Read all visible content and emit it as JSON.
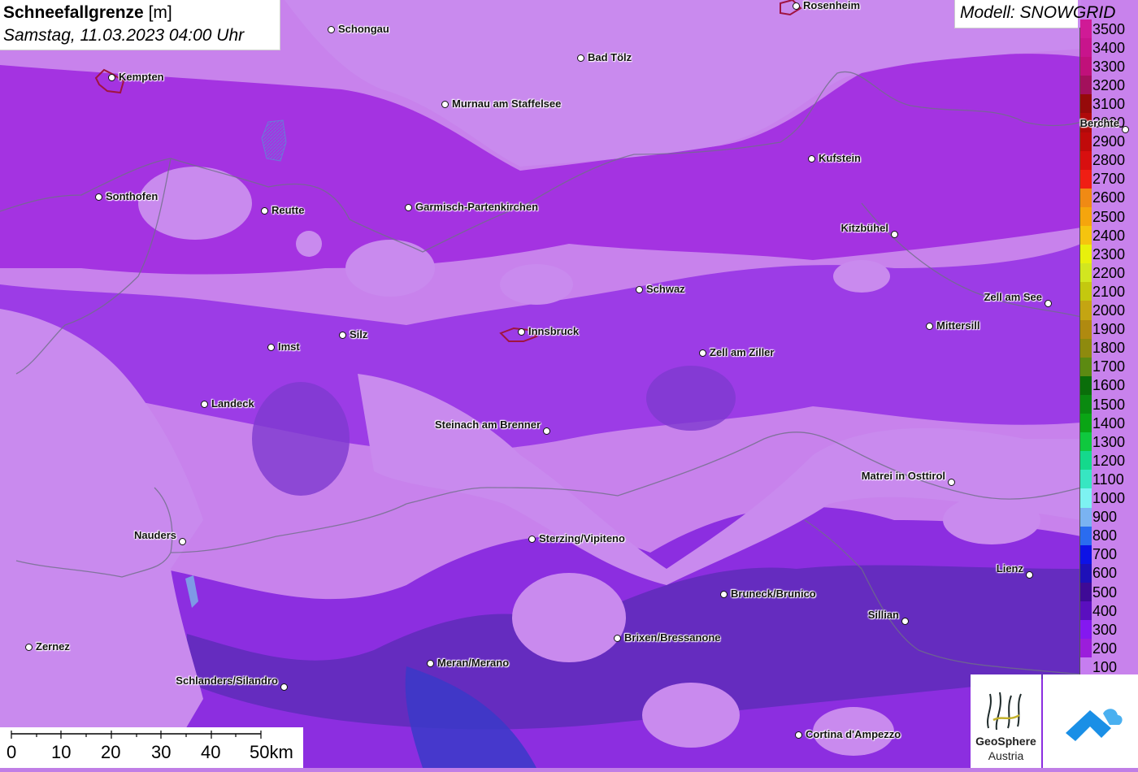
{
  "header": {
    "title_bold": "Schneefallgrenze",
    "title_unit": "[m]",
    "datetime": "Samstag, 11.03.2023 04:00 Uhr",
    "model": "Modell: SNOWGRID"
  },
  "legend": {
    "values": [
      "100",
      "200",
      "300",
      "400",
      "500",
      "600",
      "700",
      "800",
      "900",
      "1000",
      "1100",
      "1200",
      "1300",
      "1400",
      "1500",
      "1600",
      "1700",
      "1800",
      "1900",
      "2000",
      "2100",
      "2200",
      "2300",
      "2400",
      "2500",
      "2600",
      "2700",
      "2800",
      "2900",
      "3000",
      "3100",
      "3200",
      "3300",
      "3400",
      "3500"
    ],
    "colors": [
      "#c67df0",
      "#9b1ddb",
      "#8418f0",
      "#5a0fbf",
      "#3e0a96",
      "#1e10b8",
      "#0d12e6",
      "#2a6cf0",
      "#7ab3f2",
      "#7df2f2",
      "#37e6c2",
      "#14d98c",
      "#0fc83e",
      "#0aa515",
      "#0a8a10",
      "#0a6e0a",
      "#5c8a12",
      "#8e8a0e",
      "#b08a10",
      "#c4a512",
      "#c4c80f",
      "#d2e620",
      "#e8f00c",
      "#f5c40f",
      "#f5a50d",
      "#f08a14",
      "#f01e14",
      "#d80f0f",
      "#c00a0a",
      "#b00a0a",
      "#960a0a",
      "#a3105c",
      "#c0107a",
      "#c8148c",
      "#d01a96"
    ]
  },
  "cities": [
    {
      "name": "Rosenheim"
    },
    {
      "name": "Schongau"
    },
    {
      "name": "Bad Tölz"
    },
    {
      "name": "Kempten"
    },
    {
      "name": "Murnau am Staffelsee"
    },
    {
      "name": "Berchte"
    },
    {
      "name": "Kufstein"
    },
    {
      "name": "Sonthofen"
    },
    {
      "name": "Reutte"
    },
    {
      "name": "Garmisch-Partenkirchen"
    },
    {
      "name": "Kitzbühel"
    },
    {
      "name": "Schwaz"
    },
    {
      "name": "Zell am See"
    },
    {
      "name": "Mittersill"
    },
    {
      "name": "Silz"
    },
    {
      "name": "Innsbruck"
    },
    {
      "name": "Imst"
    },
    {
      "name": "Zell am Ziller"
    },
    {
      "name": "Landeck"
    },
    {
      "name": "Steinach am Brenner"
    },
    {
      "name": "Matrei in Osttirol"
    },
    {
      "name": "Nauders"
    },
    {
      "name": "Sterzing/Vipiteno"
    },
    {
      "name": "Lienz"
    },
    {
      "name": "Bruneck/Brunico"
    },
    {
      "name": "Sillian"
    },
    {
      "name": "Brixen/Bressanone"
    },
    {
      "name": "Zernez"
    },
    {
      "name": "Meran/Merano"
    },
    {
      "name": "Schlanders/Silandro"
    },
    {
      "name": "Cortina d'Ampezzo"
    }
  ],
  "scale": {
    "labels": [
      "0",
      "10",
      "20",
      "30",
      "40",
      "50km"
    ]
  },
  "logos": {
    "geosphere_line1": "GeoSphere",
    "geosphere_line2": "Austria"
  }
}
